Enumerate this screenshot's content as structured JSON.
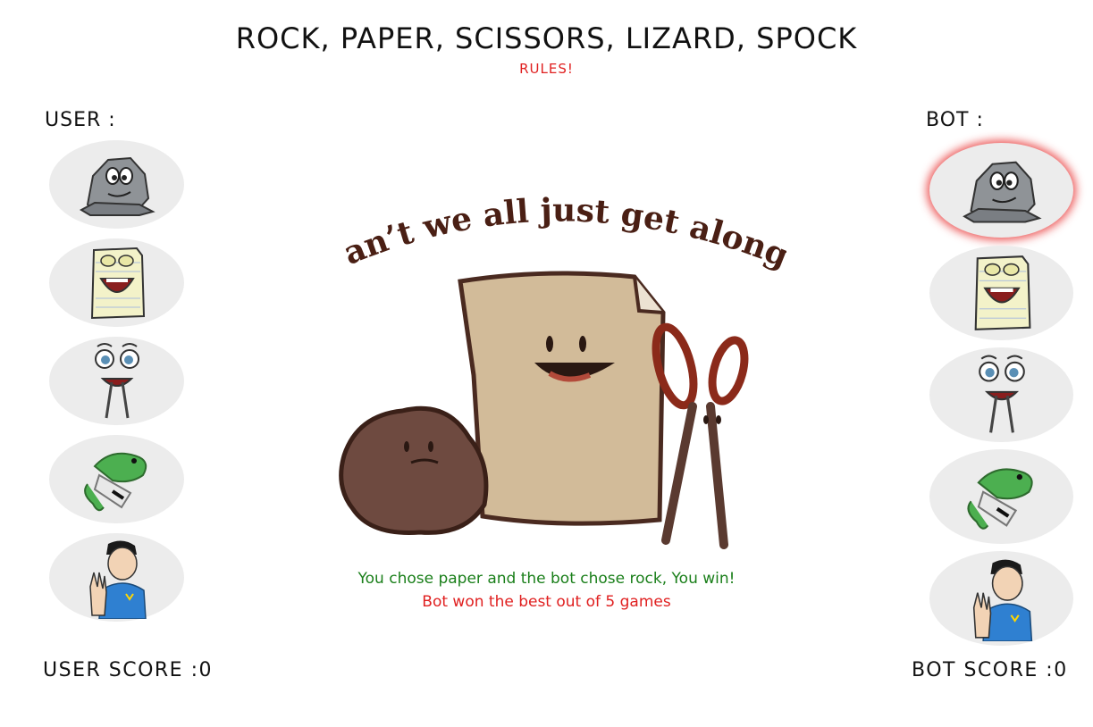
{
  "title": "ROCK, PAPER, SCISSORS, LIZARD, SPOCK",
  "rules_link": "RULES!",
  "user": {
    "label": "USER :",
    "score_text": "USER SCORE :0",
    "choices": [
      "rock",
      "paper",
      "scissors",
      "lizard",
      "spock"
    ]
  },
  "bot": {
    "label": "BOT :",
    "score_text": "BOT SCORE :0",
    "selected_choice": "rock",
    "choices": [
      "rock",
      "paper",
      "scissors",
      "lizard",
      "spock"
    ]
  },
  "banner": "Can’t we all just get along?",
  "result_text": "You chose paper and the bot chose rock, You win!",
  "summary_text": "Bot won the best out of 5 games",
  "colors": {
    "result": "#1a7f1a",
    "summary": "#e02020",
    "rules": "#e02020",
    "selected_glow": "#e61e1e"
  }
}
